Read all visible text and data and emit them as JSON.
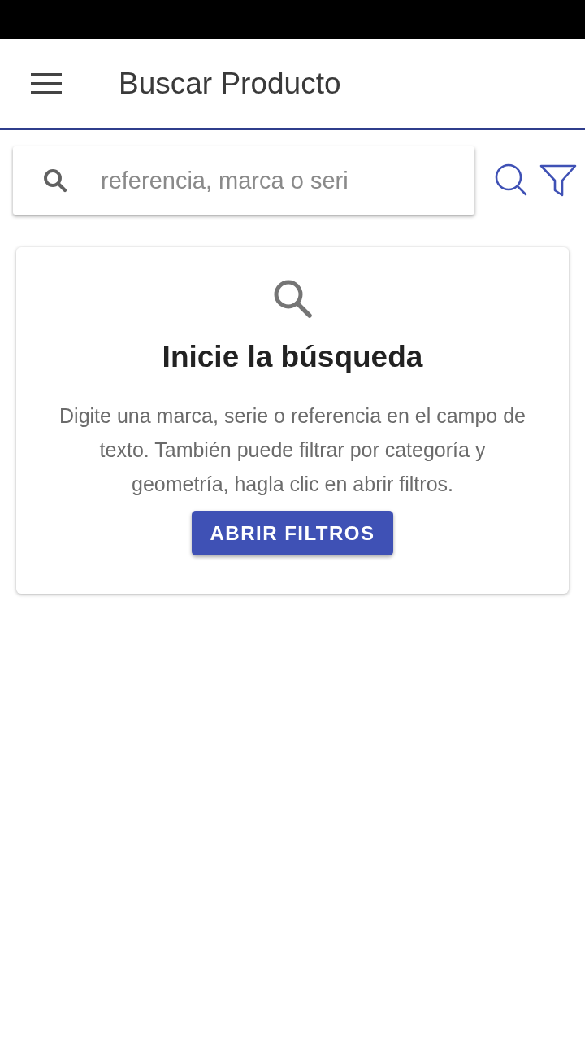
{
  "app_bar": {
    "title": "Buscar Producto"
  },
  "search": {
    "placeholder": "referencia, marca o seri"
  },
  "empty_state": {
    "title": "Inicie la búsqueda",
    "message": "Digite una marca, serie o referencia en el campo de texto. También puede filtrar por categoría y geometría, hagla clic en abrir filtros.",
    "button": "ABRIR FILTROS"
  }
}
